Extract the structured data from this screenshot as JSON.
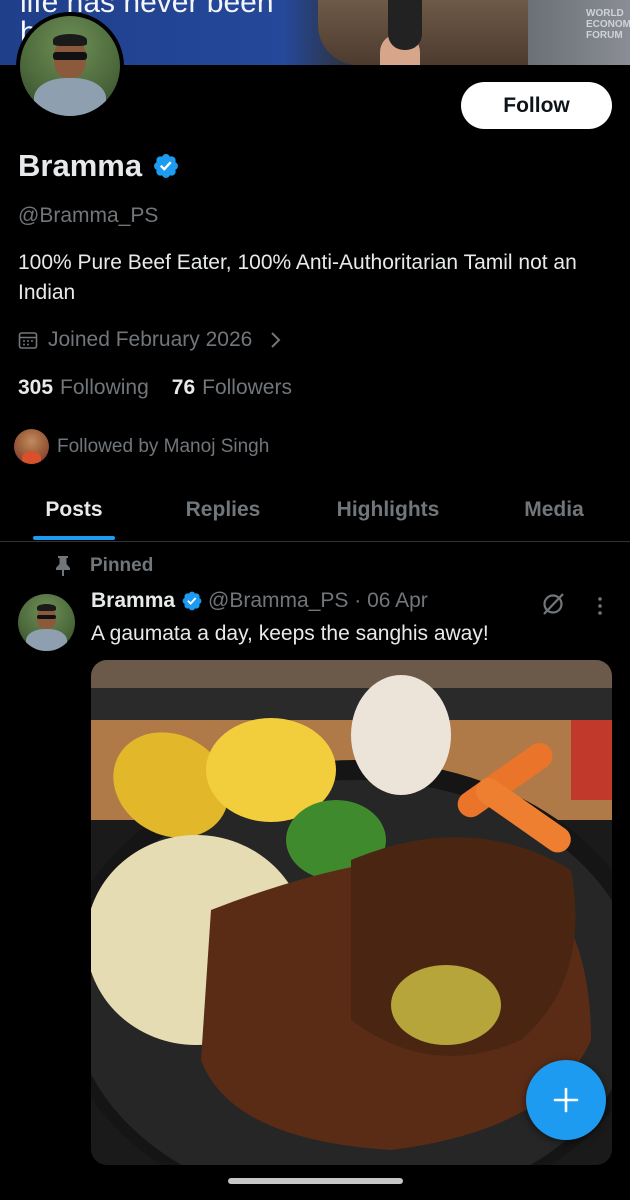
{
  "banner": {
    "text_line1": "life has never been",
    "text_line2": "h",
    "logo_text": "WORLD\nECONOMIC\nFORUM"
  },
  "profile": {
    "follow_label": "Follow",
    "name": "Bramma",
    "handle": "@Bramma_PS",
    "bio": "100% Pure Beef Eater, 100% Anti-Authoritarian   Tamil not an Indian",
    "joined": "Joined February 2026",
    "following_count": "305",
    "following_label": "Following",
    "followers_count": "76",
    "followers_label": "Followers",
    "followed_by": "Followed by Manoj Singh"
  },
  "tabs": [
    {
      "label": "Posts",
      "active": true
    },
    {
      "label": "Replies",
      "active": false
    },
    {
      "label": "Highlights",
      "active": false
    },
    {
      "label": "Media",
      "active": false
    }
  ],
  "post": {
    "pinned_label": "Pinned",
    "author_name": "Bramma",
    "meta": "@Bramma_PS · 06 Apr",
    "text": "A gaumata a day, keeps the sanghis away!"
  },
  "icons": {
    "verified": "verified-badge-icon",
    "calendar": "calendar-icon",
    "chevron": "chevron-right-icon",
    "pin": "pin-icon",
    "grok": "grok-icon",
    "more": "more-vertical-icon",
    "compose": "plus-icon"
  },
  "colors": {
    "accent": "#1d9bf0",
    "background": "#000000",
    "text_primary": "#e7e9ea",
    "text_secondary": "#71767b"
  }
}
